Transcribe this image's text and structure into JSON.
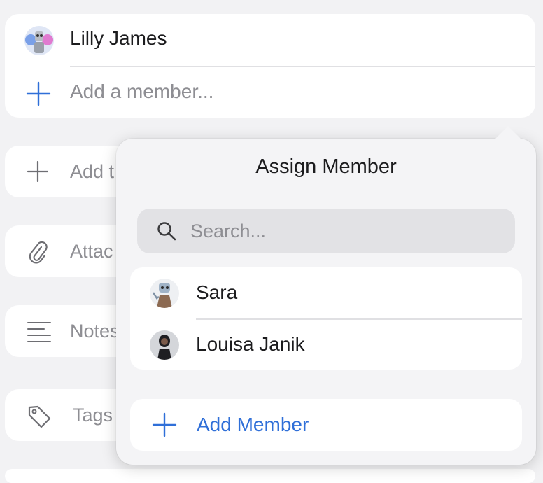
{
  "members": {
    "items": [
      {
        "name": "Lilly James"
      }
    ],
    "add_placeholder": "Add a member..."
  },
  "rows": [
    {
      "label": "Add t",
      "icon": "plus-icon"
    },
    {
      "label": "Attac",
      "icon": "paperclip-icon"
    },
    {
      "label": "Notes",
      "icon": "notes-icon"
    },
    {
      "label": "Tags",
      "icon": "tag-icon"
    }
  ],
  "popover": {
    "title": "Assign Member",
    "search_placeholder": "Search...",
    "members": [
      {
        "name": "Sara"
      },
      {
        "name": "Louisa Janik"
      }
    ],
    "add_label": "Add Member"
  },
  "colors": {
    "accent": "#2f6fd8",
    "secondary_text": "#8e8e93",
    "background": "#f2f2f4"
  }
}
